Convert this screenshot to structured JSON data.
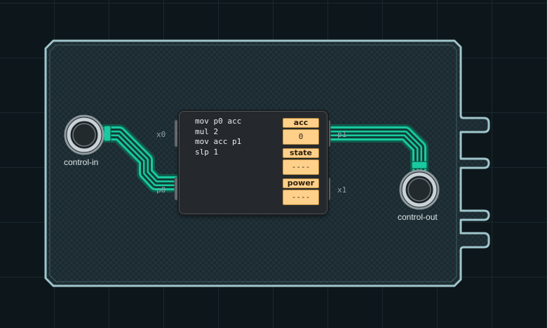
{
  "board": {
    "colors": {
      "wire": "#19c9a0",
      "board_edge": "#9fc6cc",
      "register": "#ffd08a"
    }
  },
  "sensors": {
    "input_label": "control-in",
    "output_label": "control-out"
  },
  "controller": {
    "code_lines": [
      "mov p0 acc",
      "mul 2",
      "mov acc p1",
      "slp 1"
    ],
    "pins": {
      "x0": "x0",
      "p0": "p0",
      "p1": "p1",
      "x1": "x1"
    },
    "registers": [
      {
        "name": "acc",
        "value": "0"
      },
      {
        "name": "state",
        "value": "----"
      },
      {
        "name": "power",
        "value": "----"
      }
    ]
  }
}
